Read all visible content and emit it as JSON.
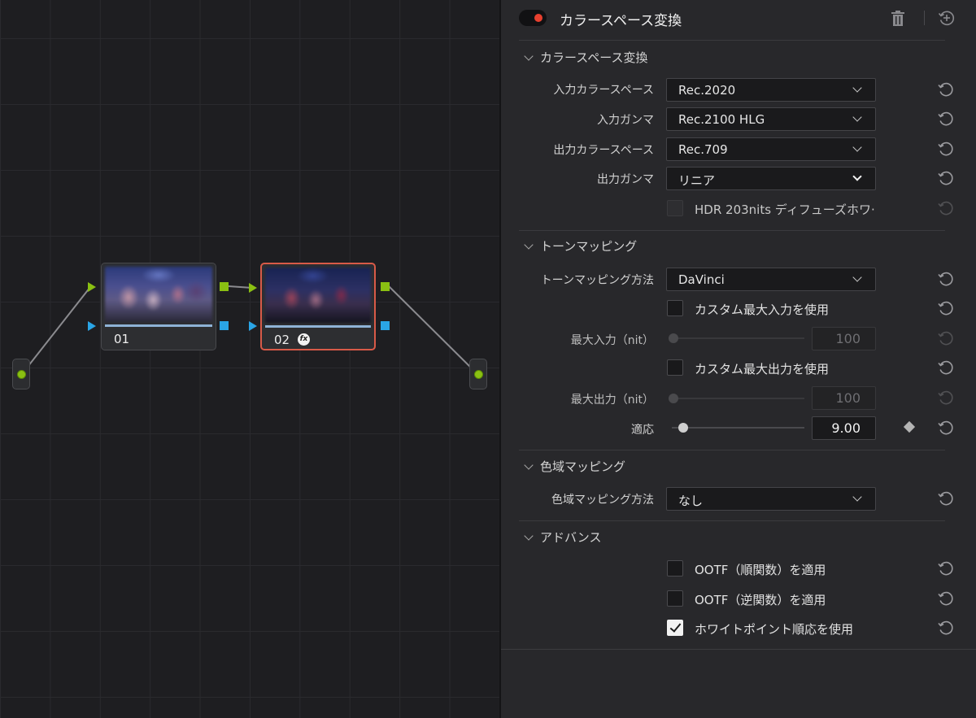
{
  "node_graph": {
    "nodes": [
      {
        "label": "01",
        "selected": false
      },
      {
        "label": "02",
        "selected": true,
        "badge": "fx"
      }
    ],
    "colors": {
      "rgb_port": "#8ac012",
      "alpha_port": "#2aa5e6",
      "selected_border": "#d85a48"
    }
  },
  "panel": {
    "title": "カラースペース変換",
    "enabled": true,
    "header_icons": [
      "trash-icon",
      "reset-all-icon"
    ]
  },
  "sections": {
    "csc": {
      "title": "カラースペース変換",
      "input_colorspace": {
        "label": "入力カラースペース",
        "value": "Rec.2020"
      },
      "input_gamma": {
        "label": "入力ガンマ",
        "value": "Rec.2100 HLG"
      },
      "output_colorspace": {
        "label": "出力カラースペース",
        "value": "Rec.709"
      },
      "output_gamma": {
        "label": "出力ガンマ",
        "value": "リニア"
      },
      "hdr_white": {
        "label": "HDR 203nits ディフューズホワ·",
        "checked": false,
        "enabled": false
      }
    },
    "tone": {
      "title": "トーンマッピング",
      "method": {
        "label": "トーンマッピング方法",
        "value": "DaVinci"
      },
      "custom_max_input": {
        "label": "カスタム最大入力を使用",
        "checked": false
      },
      "max_input": {
        "label": "最大入力（nit）",
        "value": "100",
        "enabled": false
      },
      "custom_max_output": {
        "label": "カスタム最大出力を使用",
        "checked": false
      },
      "max_output": {
        "label": "最大出力（nit）",
        "value": "100",
        "enabled": false
      },
      "adaptation": {
        "label": "適応",
        "value": "9.00"
      }
    },
    "gamut": {
      "title": "色域マッピング",
      "method": {
        "label": "色域マッピング方法",
        "value": "なし"
      }
    },
    "advanced": {
      "title": "アドバンス",
      "ootf_forward": {
        "label": "OOTF（順関数）を適用",
        "checked": false
      },
      "ootf_inverse": {
        "label": "OOTF（逆関数）を適用",
        "checked": false
      },
      "white_point_adapt": {
        "label": "ホワイトポイント順応を使用",
        "checked": true
      }
    }
  }
}
